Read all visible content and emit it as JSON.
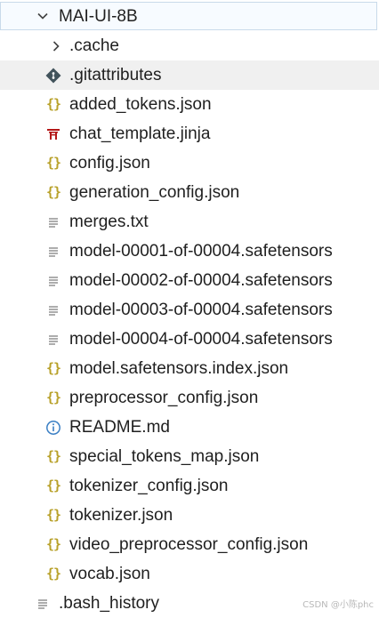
{
  "explorer": {
    "root": {
      "label": "MAI-UI-8B",
      "icon": "chevron-down-icon"
    },
    "items": [
      {
        "label": ".cache",
        "icon": "chevron-right-icon"
      },
      {
        "label": ".gitattributes",
        "icon": "git-icon"
      },
      {
        "label": "added_tokens.json",
        "icon": "json-braces-icon"
      },
      {
        "label": "chat_template.jinja",
        "icon": "jinja-icon"
      },
      {
        "label": "config.json",
        "icon": "json-braces-icon"
      },
      {
        "label": "generation_config.json",
        "icon": "json-braces-icon"
      },
      {
        "label": "merges.txt",
        "icon": "text-lines-icon"
      },
      {
        "label": "model-00001-of-00004.safetensors",
        "icon": "text-lines-icon"
      },
      {
        "label": "model-00002-of-00004.safetensors",
        "icon": "text-lines-icon"
      },
      {
        "label": "model-00003-of-00004.safetensors",
        "icon": "text-lines-icon"
      },
      {
        "label": "model-00004-of-00004.safetensors",
        "icon": "text-lines-icon"
      },
      {
        "label": "model.safetensors.index.json",
        "icon": "json-braces-icon"
      },
      {
        "label": "preprocessor_config.json",
        "icon": "json-braces-icon"
      },
      {
        "label": "README.md",
        "icon": "info-icon"
      },
      {
        "label": "special_tokens_map.json",
        "icon": "json-braces-icon"
      },
      {
        "label": "tokenizer_config.json",
        "icon": "json-braces-icon"
      },
      {
        "label": "tokenizer.json",
        "icon": "json-braces-icon"
      },
      {
        "label": "video_preprocessor_config.json",
        "icon": "json-braces-icon"
      },
      {
        "label": "vocab.json",
        "icon": "json-braces-icon"
      }
    ],
    "sibling": {
      "label": ".bash_history",
      "icon": "text-lines-icon"
    },
    "colors": {
      "json": "#b8a12a",
      "info": "#3a7fc4",
      "git": "#41535b",
      "jinja": "#b41717",
      "selected": "#f0f0f0"
    }
  },
  "watermark": "CSDN @小陈phc"
}
